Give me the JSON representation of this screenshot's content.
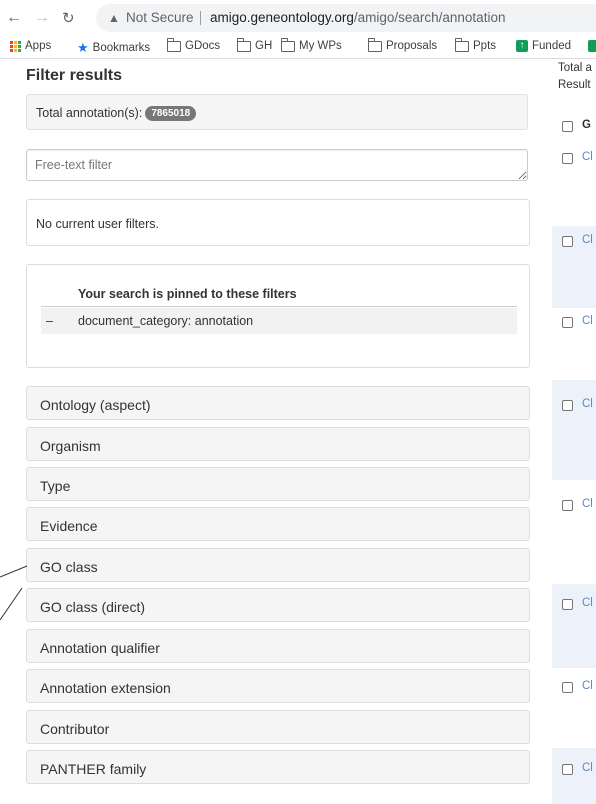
{
  "browser": {
    "security_label": "Not Secure",
    "url_domain": "amigo.geneontology.org",
    "url_path": "/amigo/search/annotation",
    "bookmarks": [
      "Apps",
      "Bookmarks",
      "GDocs",
      "GH",
      "My WPs",
      "Proposals",
      "Ppts",
      "Funded"
    ]
  },
  "filter": {
    "title": "Filter results",
    "total_label": "Total annotation(s):",
    "total_count": "7865018",
    "freetext_placeholder": "Free-text filter",
    "user_filters_text": "No current user filters.",
    "pinned_header": "Your search is pinned to these filters",
    "pinned_remove": "–",
    "pinned_value": "document_category: annotation",
    "facets": [
      "Ontology (aspect)",
      "Organism",
      "Type",
      "Evidence",
      "GO class",
      "GO class (direct)",
      "Annotation qualifier",
      "Annotation extension",
      "Contributor",
      "PANTHER family"
    ]
  },
  "results": {
    "total_label_partial": "Total a",
    "results_label_partial": "Result",
    "header_partial": "G",
    "row_link_partial": "Cl"
  },
  "colors": {
    "link": "#5a8ac6",
    "badge": "#777777",
    "alt_row": "#edf1fa"
  }
}
